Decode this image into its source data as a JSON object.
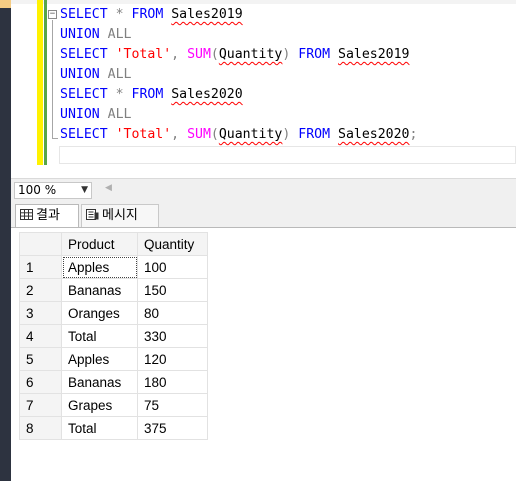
{
  "editor": {
    "lines": [
      [
        {
          "t": "SELECT",
          "c": "kw"
        },
        {
          "t": " "
        },
        {
          "t": "*",
          "c": "op"
        },
        {
          "t": " "
        },
        {
          "t": "FROM",
          "c": "kw"
        },
        {
          "t": " "
        },
        {
          "t": "Sales2019",
          "c": "sq"
        }
      ],
      [
        {
          "t": "UNION",
          "c": "kw"
        },
        {
          "t": " "
        },
        {
          "t": "ALL",
          "c": "op"
        }
      ],
      [
        {
          "t": "SELECT",
          "c": "kw"
        },
        {
          "t": " "
        },
        {
          "t": "'Total'",
          "c": "str"
        },
        {
          "t": ",",
          "c": "op"
        },
        {
          "t": " "
        },
        {
          "t": "SUM",
          "c": "fn"
        },
        {
          "t": "(",
          "c": "op"
        },
        {
          "t": "Quantity",
          "c": "sq"
        },
        {
          "t": ")",
          "c": "op"
        },
        {
          "t": " "
        },
        {
          "t": "FROM",
          "c": "kw"
        },
        {
          "t": " "
        },
        {
          "t": "Sales2019",
          "c": "sq"
        }
      ],
      [
        {
          "t": "UNION",
          "c": "kw"
        },
        {
          "t": " "
        },
        {
          "t": "ALL",
          "c": "op"
        }
      ],
      [
        {
          "t": "SELECT",
          "c": "kw"
        },
        {
          "t": " "
        },
        {
          "t": "*",
          "c": "op"
        },
        {
          "t": " "
        },
        {
          "t": "FROM",
          "c": "kw"
        },
        {
          "t": " "
        },
        {
          "t": "Sales2020",
          "c": "sq"
        }
      ],
      [
        {
          "t": "UNION",
          "c": "kw"
        },
        {
          "t": " "
        },
        {
          "t": "ALL",
          "c": "op"
        }
      ],
      [
        {
          "t": "SELECT",
          "c": "kw"
        },
        {
          "t": " "
        },
        {
          "t": "'Total'",
          "c": "str"
        },
        {
          "t": ",",
          "c": "op"
        },
        {
          "t": " "
        },
        {
          "t": "SUM",
          "c": "fn"
        },
        {
          "t": "(",
          "c": "op"
        },
        {
          "t": "Quantity",
          "c": "sq"
        },
        {
          "t": ")",
          "c": "op"
        },
        {
          "t": " "
        },
        {
          "t": "FROM",
          "c": "kw"
        },
        {
          "t": " "
        },
        {
          "t": "Sales2020",
          "c": "sq"
        },
        {
          "t": ";",
          "c": "op"
        }
      ]
    ]
  },
  "zoom": {
    "value": "100 %"
  },
  "tabs": {
    "results": "결과",
    "messages": "메시지"
  },
  "results": {
    "columns": [
      "Product",
      "Quantity"
    ],
    "rows": [
      {
        "n": "1",
        "product": "Apples",
        "quantity": "100"
      },
      {
        "n": "2",
        "product": "Bananas",
        "quantity": "150"
      },
      {
        "n": "3",
        "product": "Oranges",
        "quantity": "80"
      },
      {
        "n": "4",
        "product": "Total",
        "quantity": "330"
      },
      {
        "n": "5",
        "product": "Apples",
        "quantity": "120"
      },
      {
        "n": "6",
        "product": "Bananas",
        "quantity": "180"
      },
      {
        "n": "7",
        "product": "Grapes",
        "quantity": "75"
      },
      {
        "n": "8",
        "product": "Total",
        "quantity": "375"
      }
    ]
  }
}
